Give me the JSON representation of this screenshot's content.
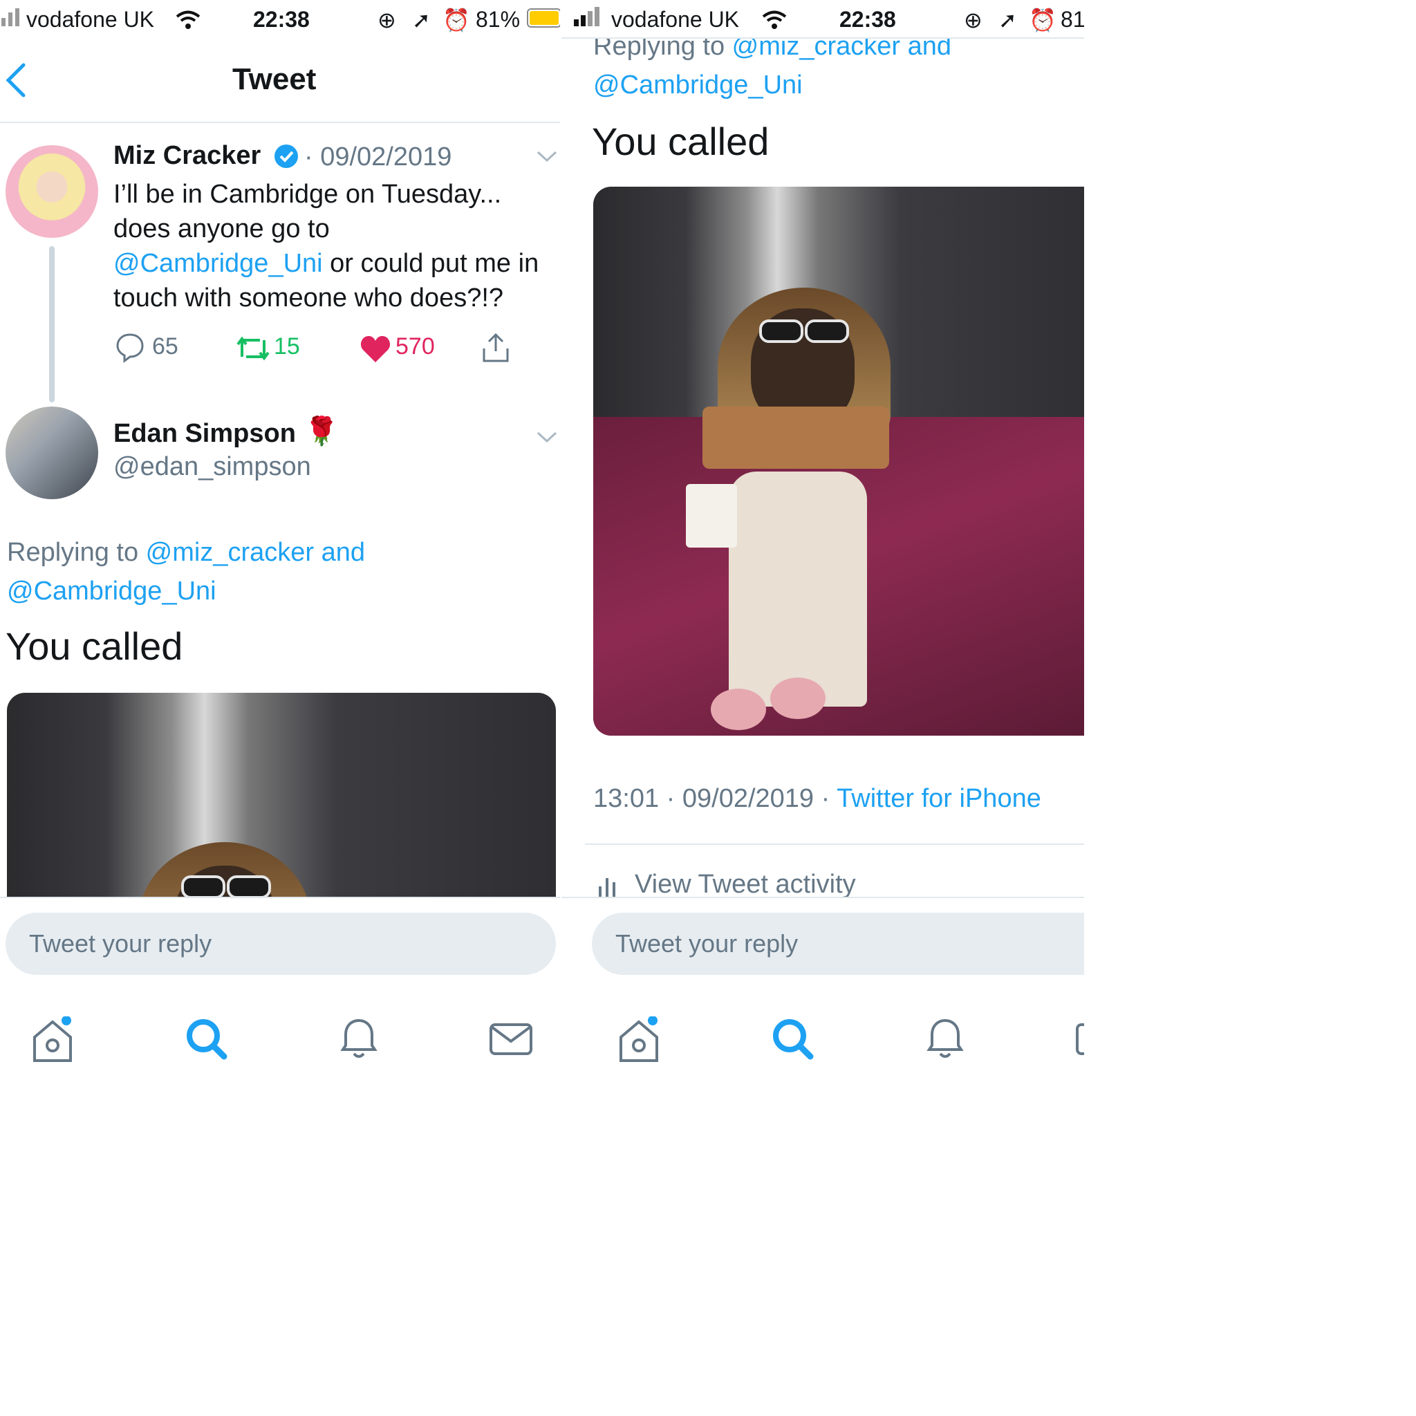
{
  "colors": {
    "accent": "#1da1f2",
    "like": "#e0245e",
    "retweet": "#17bf63",
    "battery": "#ffcc00",
    "secondary_text": "#657786"
  },
  "left": {
    "status": {
      "carrier": "vodafone UK",
      "time": "22:38",
      "battery": "81%"
    },
    "header": {
      "title": "Tweet"
    },
    "parent_tweet": {
      "author": "Miz Cracker",
      "date": "09/02/2019",
      "text_line1": "I’ll be in Cambridge on Tuesday...",
      "text_line2": "does anyone go to",
      "mention": "@Cambridge_Uni",
      "text_line3_rest": " or could put me in",
      "text_line4": "touch with someone who does?!?",
      "replies": "65",
      "retweets": "15",
      "likes": "570"
    },
    "reply_tweet": {
      "author": "Edan Simpson",
      "emoji": "🌹",
      "handle": "@edan_simpson",
      "replying_prefix": "Replying to ",
      "replying_mention1": "@miz_cracker and",
      "replying_mention2": "@Cambridge_Uni",
      "text": "You called"
    },
    "reply_box": {
      "placeholder": "Tweet your reply"
    }
  },
  "right": {
    "status": {
      "carrier": "vodafone UK",
      "time": "22:38",
      "battery": "81"
    },
    "replying_prefix": "Replying to ",
    "replying_mention1": "@miz_cracker and",
    "replying_mention2": "@Cambridge_Uni",
    "text": "You called",
    "meta": {
      "time": "13:01",
      "date": "09/02/2019",
      "sep": " · ",
      "source": "Twitter for iPhone"
    },
    "activity": "View Tweet activity",
    "reply_box": {
      "placeholder": "Tweet your reply"
    }
  },
  "icons": [
    "home-icon",
    "search-icon",
    "notifications-icon",
    "messages-icon"
  ]
}
